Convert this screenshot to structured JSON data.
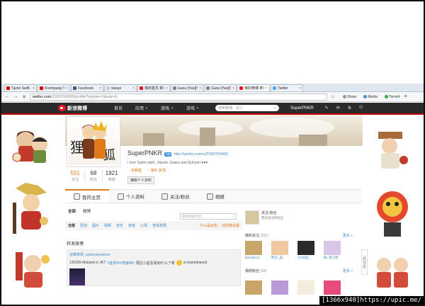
{
  "browser": {
    "tabs": [
      {
        "label": "Taylor Swift - ",
        "color": "#cc0000",
        "active": false
      },
      {
        "label": "Knompang Tu",
        "color": "#cc0000",
        "active": false
      },
      {
        "label": "Facebook",
        "color": "#3b5998",
        "active": false
      },
      {
        "label": "siwupi",
        "color": "#cccccc",
        "active": false
      },
      {
        "label": "我的首页 新浪",
        "color": "#e6162d",
        "active": false
      },
      {
        "label": "Gana [Yao][Tra",
        "color": "#888888",
        "active": false
      },
      {
        "label": "Gana [Yao][Tra",
        "color": "#888888",
        "active": false
      },
      {
        "label": "我的微博 新浪",
        "color": "#e6162d",
        "active": true
      },
      {
        "label": "Twitter",
        "color": "#55acee",
        "active": false
      }
    ],
    "url_domain": "weibo.com",
    "url_path": "/2303704365/profile?topnav=1&wvr=5",
    "extensions": [
      "Share",
      "Media",
      "Torrent"
    ]
  },
  "weibo_nav": {
    "logo_text": "新浪微博",
    "menu": [
      "首页",
      "应用",
      "游戏",
      "游戏"
    ],
    "search_placeholder": "搜索微博、找人",
    "username": "SuperPNKR"
  },
  "profile": {
    "name": "SuperPNKR",
    "vip_badge": "vip",
    "link": "http://weibo.com/u/2303704365",
    "bio": "I love Taylor swift , Naruto ,Gaara and Kjuhyun ♥♥♥",
    "tags": [
      "天蝎座",
      "海外 其他"
    ],
    "edit_button": "编辑个人资料",
    "counts": [
      {
        "num": "551",
        "label": "关注",
        "highlight": true
      },
      {
        "num": "68",
        "label": "粉丝",
        "highlight": false
      },
      {
        "num": "1921",
        "label": "微博",
        "highlight": false
      }
    ]
  },
  "tabs": [
    "我的主页",
    "个人资料",
    "关注/粉丝",
    "相册"
  ],
  "feed": {
    "filters": [
      "全部",
      "微博"
    ],
    "search_placeholder": "搜索我说的话",
    "subfilters": [
      "全部",
      "原创",
      "图片",
      "视频",
      "音乐",
      "标签",
      "心情",
      "查看权限"
    ],
    "subfilter_right": [
      "什么是动态",
      "动态微设置"
    ],
    "section_title": "转发微博",
    "post_author": "@泰软软_sumirekyuwoon",
    "post_text_a": "130309 Mubank in JKT",
    "post_text_hl": "#金贤中#李赫宰#",
    "post_text_b": "周拉小盆友看到什么了呀",
    "post_text_c": "or.teukiebiased"
  },
  "side": {
    "title": "关注·粉丝",
    "subtitle": "我的关注和粉丝",
    "follow_label": "我的关注",
    "follow_count": "(551)",
    "more": "更多 »",
    "friends": [
      {
        "name": "bluelale13",
        "color": "#c9a56a"
      },
      {
        "name": "晓子_蓝...",
        "color": "#f0c8a0"
      },
      {
        "name": "小GB是...",
        "color": "#2a2a2a"
      },
      {
        "name": "咪_李小赫",
        "color": "#d9c6e8"
      }
    ],
    "fans_label": "我的粉丝",
    "fans_count": "(68)",
    "fans": [
      {
        "color": "#c9a56a"
      },
      {
        "color": "#b999d6"
      },
      {
        "color": "#f2eddc"
      },
      {
        "color": "#e64b7a"
      }
    ]
  },
  "totop_label": "返回顶部",
  "watermark": "[1366x940]https://upic.me/"
}
